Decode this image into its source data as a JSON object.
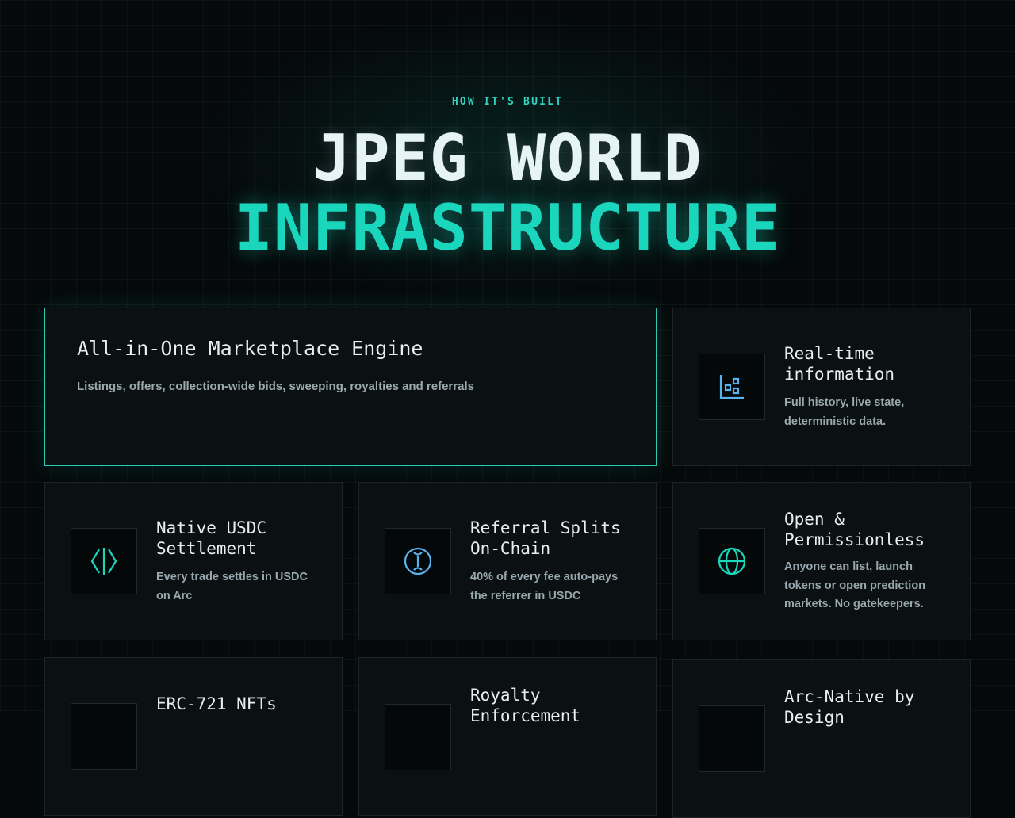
{
  "eyebrow": "HOW IT'S BUILT",
  "headline": {
    "line1": "JPEG WORLD",
    "line2": "INFRASTRUCTURE"
  },
  "featured": {
    "title": "All-in-One Marketplace Engine",
    "description": "Listings, offers, collection-wide bids, sweeping, royalties and referrals"
  },
  "cards": [
    {
      "title": "Real-time\ninformation",
      "description": "Full history, live state, deterministic data.",
      "icon": "chart-blocks-icon"
    },
    {
      "title": "Native USDC\nSettlement",
      "description": "Every trade settles in USDC on Arc",
      "icon": "diamond-split-icon"
    },
    {
      "title": "Referral Splits\nOn-Chain",
      "description": "40% of every fee auto-pays the referrer in USDC",
      "icon": "coin-split-icon"
    },
    {
      "title": "Open &\nPermissionless",
      "description": "Anyone can list, launch tokens or open prediction markets. No gatekeepers.",
      "icon": "globe-icon"
    },
    {
      "title": "ERC-721 NFTs",
      "description": "",
      "icon": "nft-icon"
    },
    {
      "title": "Royalty\nEnforcement",
      "description": "",
      "icon": "royalty-icon"
    },
    {
      "title": "Arc-Native by\nDesign",
      "description": "",
      "icon": "arc-icon"
    }
  ],
  "colors": {
    "accent": "#1ad6bd",
    "background": "#05090a",
    "card": "#0b1112"
  }
}
